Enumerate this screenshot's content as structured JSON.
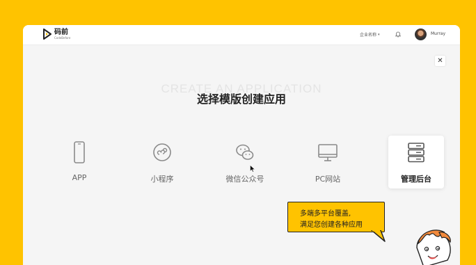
{
  "header": {
    "logo_title": "码前",
    "logo_subtitle": "CodeBefore",
    "company_label": "企业名称",
    "username": "Murray"
  },
  "main": {
    "watermark": "CREATE AN APPLICATION",
    "title": "选择模版创建应用",
    "templates": [
      {
        "label": "APP",
        "icon": "phone-icon"
      },
      {
        "label": "小程序",
        "icon": "mini-program-icon"
      },
      {
        "label": "微信公众号",
        "icon": "wechat-icon"
      },
      {
        "label": "PC网站",
        "icon": "monitor-icon"
      },
      {
        "label": "管理后台",
        "icon": "server-icon"
      }
    ],
    "selected_template": "管理后台",
    "tooltip": {
      "line1": "多端多平台覆盖,",
      "line2": "满足您创建各种应用"
    }
  },
  "colors": {
    "background": "#FFC300",
    "panel": "#f5f5f5",
    "accent": "#FFC300"
  }
}
